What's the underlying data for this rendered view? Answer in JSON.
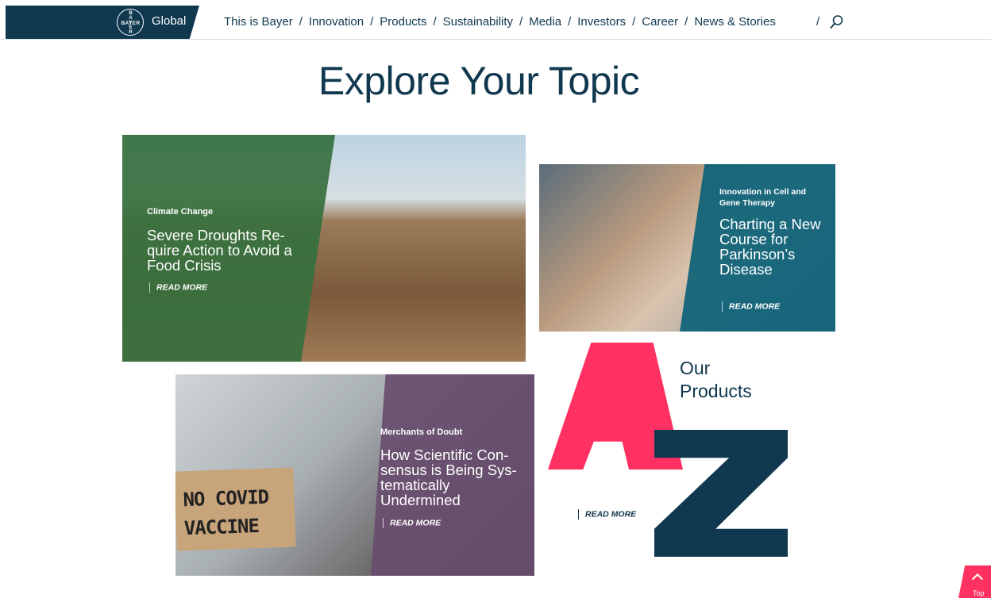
{
  "header": {
    "logo_horizontal": "BAYER",
    "logo_vertical": "BAYER",
    "region": "Global",
    "nav": [
      "This is Bayer",
      "Innovation",
      "Products",
      "Sustainability",
      "Media",
      "Investors",
      "Career",
      "News & Stories"
    ],
    "separator": "/"
  },
  "page_title": "Explore Your Topic",
  "cards": {
    "climate": {
      "category": "Climate Change",
      "headline": "Severe Droughts Re-quire Action to Avoid a Food Crisis",
      "read_more": "READ MORE"
    },
    "gene": {
      "category": "Innovation in Cell and Gene Therapy",
      "headline": "Charting a New Course for Parkinson’s Disease",
      "read_more": "READ MORE"
    },
    "doubt": {
      "category": "Merchants of Doubt",
      "headline": "How Scientific Con-sensus is Being Sys-tematically Undermined",
      "read_more": "READ MORE",
      "sign_line1": "NO COVID",
      "sign_line2": "VACCINE"
    },
    "products": {
      "title_line1": "Our",
      "title_line2": "Products",
      "read_more": "READ MORE"
    }
  },
  "top_button": "Top",
  "colors": {
    "navy": "#10384f",
    "green_panel": "#36703e",
    "teal_panel": "#0e6278",
    "purple_panel": "#684d6e",
    "pink": "#ff3162"
  },
  "icons": [
    "bayer-logo-icon",
    "search-icon",
    "chevron-up-icon"
  ]
}
